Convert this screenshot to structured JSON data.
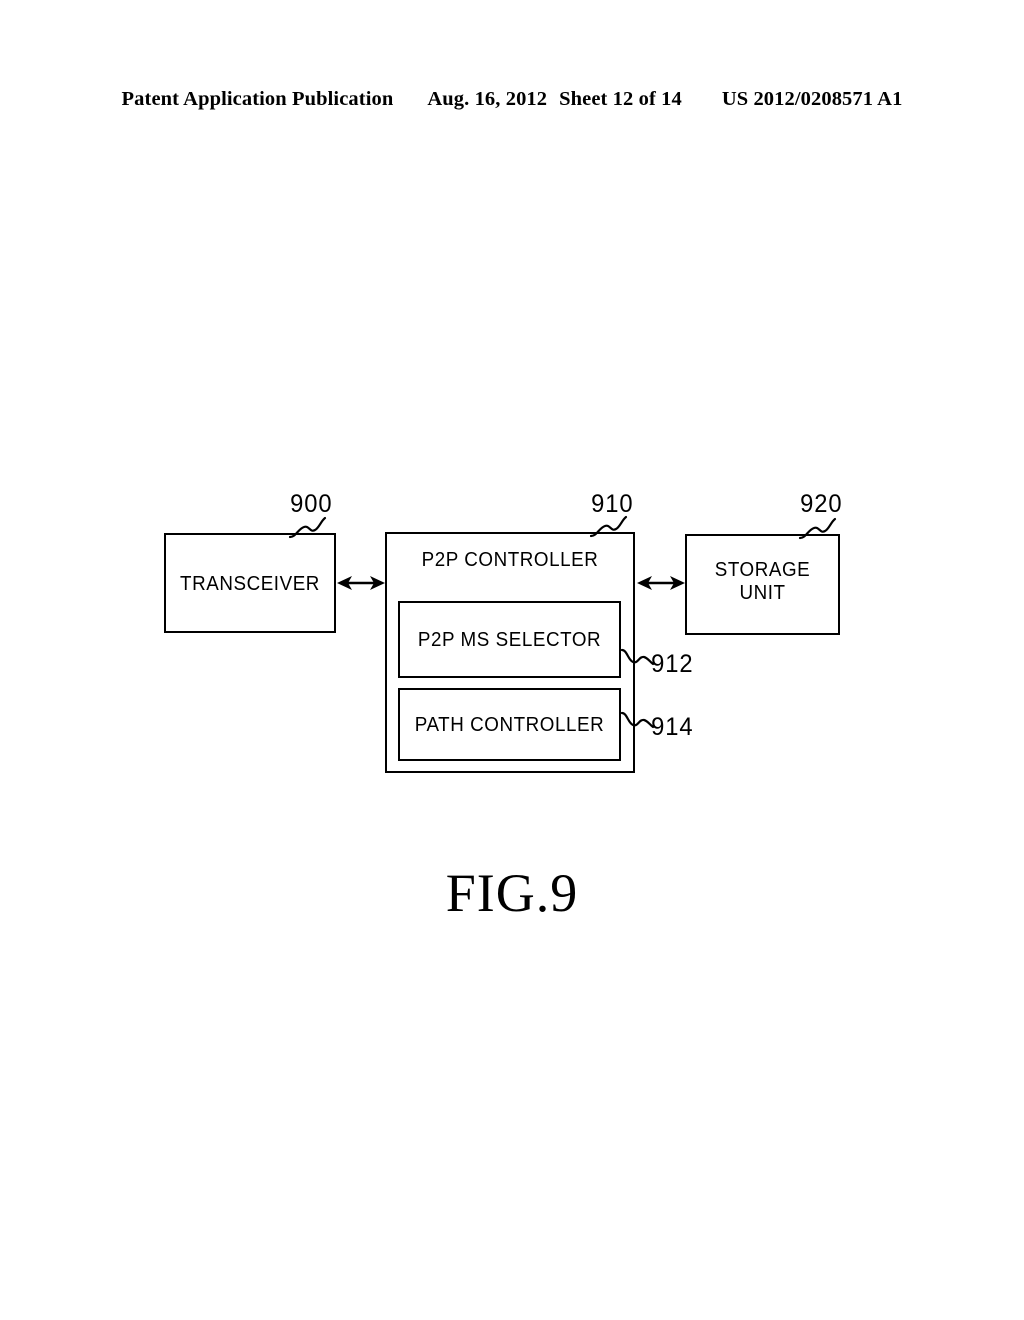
{
  "header": {
    "publication": "Patent Application Publication",
    "date": "Aug. 16, 2012",
    "sheet": "Sheet 12 of 14",
    "patent_number": "US 2012/0208571 A1"
  },
  "figure": {
    "caption": "FIG.9",
    "blocks": [
      {
        "id": "transceiver",
        "label": "TRANSCEIVER",
        "ref": "900"
      },
      {
        "id": "p2p_controller",
        "label": "P2P CONTROLLER",
        "ref": "910"
      },
      {
        "id": "p2p_ms_selector",
        "label": "P2P MS SELECTOR",
        "ref": "912"
      },
      {
        "id": "path_controller",
        "label": "PATH CONTROLLER",
        "ref": "914"
      },
      {
        "id": "storage_unit",
        "label": "STORAGE\nUNIT",
        "ref": "920"
      }
    ],
    "connections": [
      {
        "from": "transceiver",
        "to": "p2p_controller",
        "type": "bidirectional-arrow"
      },
      {
        "from": "p2p_controller",
        "to": "storage_unit",
        "type": "bidirectional-arrow"
      }
    ]
  },
  "colors": {
    "ink": "#000000",
    "paper": "#ffffff"
  }
}
